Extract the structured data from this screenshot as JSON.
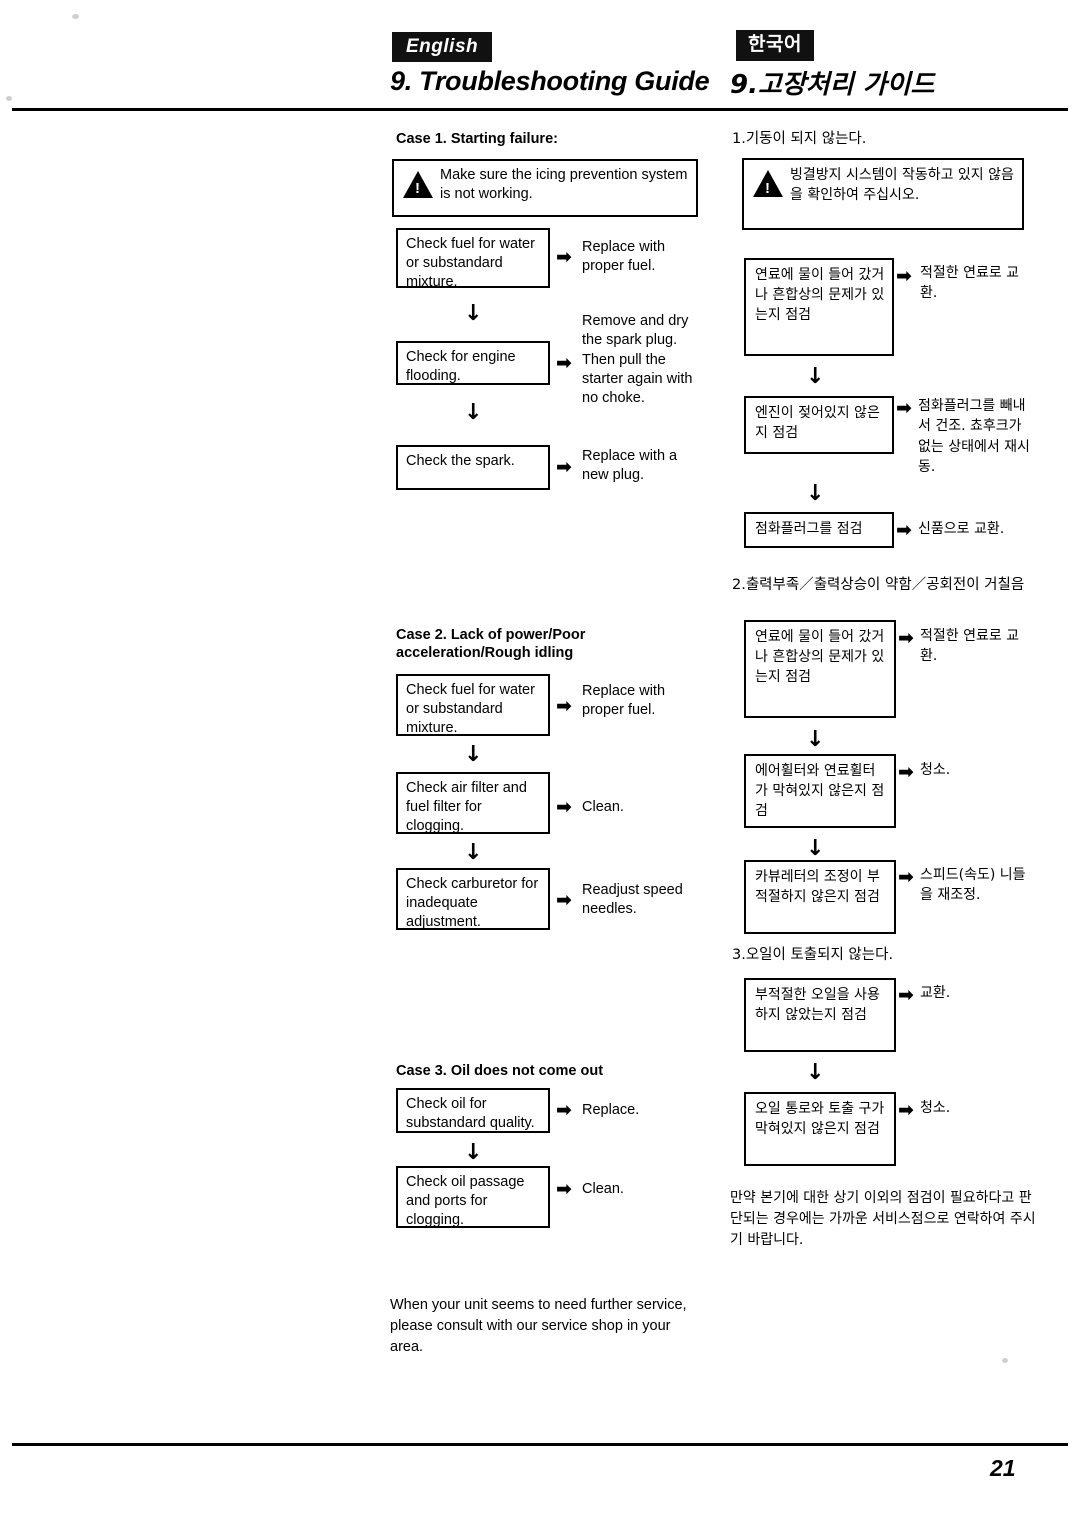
{
  "header": {
    "lang_tag_en": "English",
    "lang_tag_ko": "한국어",
    "title_en": "9. Troubleshooting Guide",
    "title_ko": "9.고장처리 가이드"
  },
  "page_number": "21",
  "english": {
    "case1": {
      "heading": "Case 1. Starting failure:",
      "warning": "Make sure the icing prevention system is not working.",
      "steps": [
        {
          "check": "Check fuel for water or substandard mixture.",
          "action": "Replace with proper fuel."
        },
        {
          "check": "Check for engine flooding.",
          "action": "Remove and dry the spark plug. Then pull the starter again with no choke."
        },
        {
          "check": "Check the spark.",
          "action": "Replace with a new plug."
        }
      ]
    },
    "case2": {
      "heading": "Case 2. Lack of power/Poor acceleration/Rough idling",
      "steps": [
        {
          "check": "Check fuel for water or substandard mixture.",
          "action": "Replace with proper fuel."
        },
        {
          "check": "Check air filter and fuel filter for clogging.",
          "action": "Clean."
        },
        {
          "check": "Check carburetor for inadequate adjustment.",
          "action": "Readjust speed needles."
        }
      ]
    },
    "case3": {
      "heading": "Case 3. Oil does not come out",
      "steps": [
        {
          "check": "Check oil for substandard quality.",
          "action": "Replace."
        },
        {
          "check": "Check oil passage and ports for clogging.",
          "action": "Clean."
        }
      ]
    },
    "footer": "When your unit seems to need further service, please consult with our service shop in your area."
  },
  "korean": {
    "case1": {
      "heading": "1.기동이 되지 않는다.",
      "warning": "빙결방지 시스템이 작동하고 있지 않음을 확인하여 주십시오.",
      "steps": [
        {
          "check": "연료에 물이 들어 갔거나 흔합상의 문제가 있는지 점검",
          "action": "적절한 연료로 교환."
        },
        {
          "check": "엔진이 젖어있지 않은지 점검",
          "action": "점화플러그를 빼내서 건조. 쵸후크가 없는 상태에서 재시동."
        },
        {
          "check": "점화플러그를 점검",
          "action": "신품으로 교환."
        }
      ]
    },
    "case2": {
      "heading": "2.출력부족／출력상승이 약함／공회전이 거칠음",
      "steps": [
        {
          "check": "연료에 물이 들어 갔거나 흔합상의 문제가 있는지 점검",
          "action": "적절한 연료로 교환."
        },
        {
          "check": "에어휠터와 연료휠터가 막혀있지 않은지 점검",
          "action": "청소."
        },
        {
          "check": "카뷰레터의 조정이 부적절하지 않은지 점검",
          "action": "스피드(속도) 니들을 재조정."
        }
      ]
    },
    "case3": {
      "heading": "3.오일이 토출되지 않는다.",
      "steps": [
        {
          "check": "부적절한 오일을 사용하지 않았는지 점검",
          "action": "교환."
        },
        {
          "check": "오일 통로와 토출 구가 막혀있지 않은지 점검",
          "action": "청소."
        }
      ]
    },
    "footer": "만약 본기에 대한 상기 이외의 점검이 필요하다고 판단되는 경우에는 가까운 서비스점으로 연락하여 주시기 바랍니다."
  },
  "icons": {
    "arrow_right": "➡",
    "arrow_down": "↓",
    "warning_mark": "!"
  }
}
